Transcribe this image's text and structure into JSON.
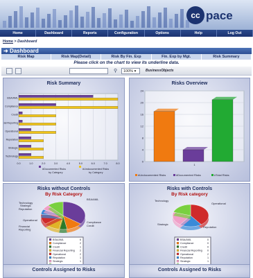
{
  "brand": {
    "logo_left": "cc",
    "logo_right": "pace"
  },
  "nav": [
    "Home",
    "Dashboard",
    "Reports",
    "Configuration",
    "Options",
    "Help",
    "Log Out"
  ],
  "breadcrumb": {
    "home": "Home",
    "sep": " > ",
    "current": "Dashboard"
  },
  "dashboard_title": "Dashboard",
  "tabs": [
    "Risk Map",
    "Risk Map(Detail)",
    "Risk By Fin. Exp",
    "Fin. Exp by Mgt.",
    "Risk Summary"
  ],
  "hint": "Please click on the chart to view its underline data.",
  "toolbar": {
    "zoom": "100%",
    "brand": "BusinessObjects"
  },
  "panels": {
    "risk_summary": {
      "title": "Risk Summary"
    },
    "risks_overview": {
      "title": "Risks Overview"
    },
    "without_controls": {
      "title": "Risks without Controls",
      "subtitle": "By Risk Category"
    },
    "with_controls": {
      "title": "Risks with Controls",
      "subtitle": "By Risk category"
    },
    "assigned_left": {
      "title": "Controls Assigned to Risks"
    },
    "assigned_right": {
      "title": "Controls Assigned to Risks"
    }
  },
  "chart_data": [
    {
      "type": "bar",
      "title": "Risk Summary",
      "orientation": "horizontal",
      "categories": [
        "BSA/AML",
        "Compliance",
        "Credit",
        "Financial Reporting",
        "Operational",
        "Reputation",
        "Strategic",
        "Technology"
      ],
      "series": [
        {
          "name": "#Documented Risks by Category",
          "color": "#6a3d9a",
          "values": [
            6,
            3,
            0.3,
            0.3,
            1,
            1,
            1,
            1
          ]
        },
        {
          "name": "#Undocumented Risks by Category",
          "color": "#f0c419",
          "values": [
            8,
            8,
            3,
            3,
            3,
            2,
            2,
            2
          ]
        }
      ],
      "xticks": [
        "0.0",
        "1.0",
        "2.0",
        "3.0",
        "4.0",
        "5.0",
        "6.0",
        "7.0",
        "8.0"
      ],
      "xlim": [
        0,
        8
      ]
    },
    {
      "type": "bar",
      "title": "Risks Overview",
      "categories": [
        "1"
      ],
      "series": [
        {
          "name": "#Undocumented Risks",
          "color": "#f07a10",
          "values": [
            17
          ]
        },
        {
          "name": "#Documented Risks",
          "color": "#6a3d9a",
          "values": [
            4
          ]
        },
        {
          "name": "#Total Risks",
          "color": "#22aa33",
          "values": [
            21
          ]
        }
      ],
      "yticks": [
        "0",
        "4",
        "8",
        "12",
        "16",
        "20",
        "24"
      ],
      "ylim": [
        0,
        24
      ]
    },
    {
      "type": "pie",
      "title": "Risks without Controls",
      "subtitle": "By Risk Category",
      "labels": [
        "BSA/AML",
        "Compliance",
        "Credit",
        "Financial Reporting",
        "Operational",
        "Reputation",
        "Strategic",
        "Technology"
      ],
      "values": [
        6,
        2,
        1,
        2,
        2,
        1,
        1,
        2
      ],
      "colors": [
        "#6a3d9a",
        "#f07a10",
        "#2a7a2a",
        "#e0b428",
        "#cf2a2a",
        "#3a8ad8",
        "#f0a0c8",
        "#7ad040"
      ],
      "total_label": "Total",
      "total": 17,
      "slice_labels": [
        "BSA/AML",
        "Compliance",
        "Credit",
        "Financial\nReporting",
        "Operational",
        "Reputation",
        "Strategic",
        "Technology"
      ]
    },
    {
      "type": "pie",
      "title": "Risks with Controls",
      "subtitle": "By Risk category",
      "labels": [
        "BSA/AML",
        "Compliance",
        "Credit",
        "Financial Reporting",
        "Operational",
        "Reputation",
        "Strategic",
        "Technology"
      ],
      "values": [
        0,
        0,
        0,
        0,
        2,
        1,
        1,
        1
      ],
      "colors": [
        "#6a3d9a",
        "#f07a10",
        "#2a7a2a",
        "#e0b428",
        "#cf2a2a",
        "#3a8ad8",
        "#f0a0c8",
        "#7ad040"
      ],
      "total_label": "Total",
      "total": 4,
      "slice_labels": [
        "Technology",
        "Operational",
        "Strategic",
        "Reputation"
      ]
    }
  ]
}
